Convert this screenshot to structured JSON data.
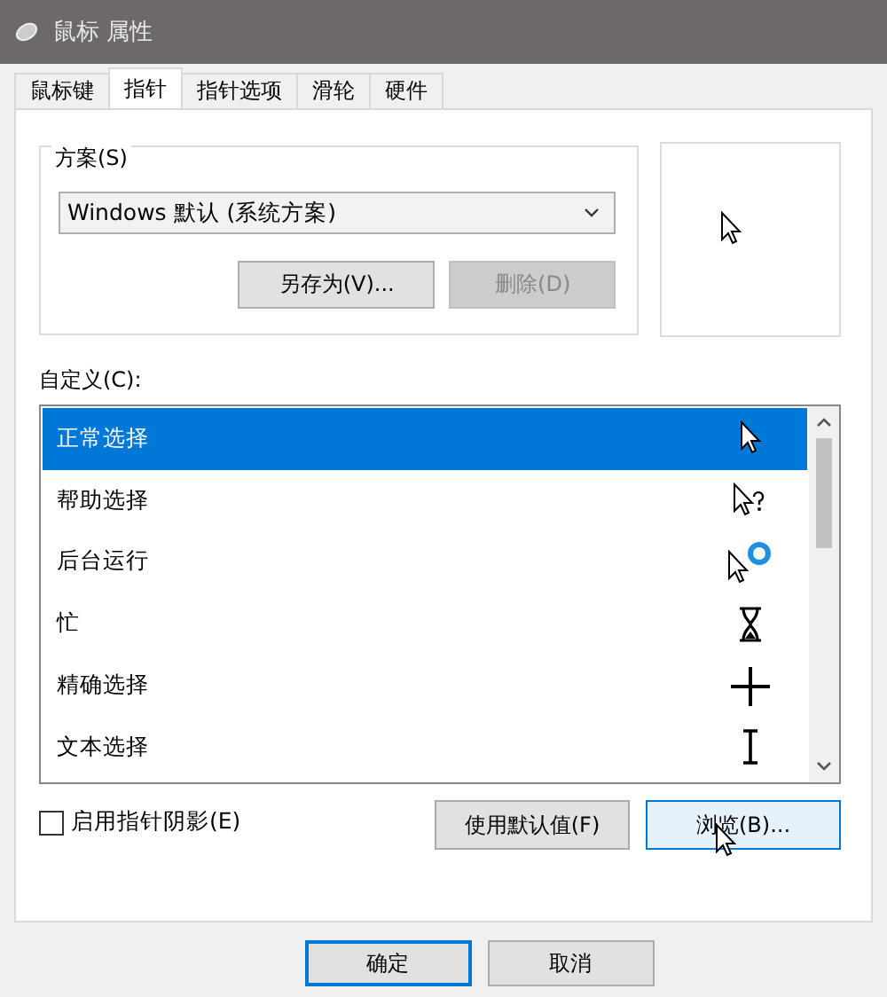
{
  "window": {
    "title": "鼠标 属性"
  },
  "tabs": [
    {
      "label": "鼠标键",
      "selected": false
    },
    {
      "label": "指针",
      "selected": true
    },
    {
      "label": "指针选项",
      "selected": false
    },
    {
      "label": "滑轮",
      "selected": false
    },
    {
      "label": "硬件",
      "selected": false
    }
  ],
  "scheme": {
    "label": "方案(S)",
    "value": "Windows 默认 (系统方案)",
    "buttons": [
      {
        "label": "另存为(V)...",
        "disabled": false
      },
      {
        "label": "删除(D)",
        "disabled": true
      }
    ],
    "preview": {
      "kind": "arrow"
    }
  },
  "customize": {
    "label": "自定义(C):",
    "items": [
      {
        "name": "正常选择",
        "kind": "arrow",
        "selected": true
      },
      {
        "name": "帮助选择",
        "kind": "help",
        "selected": false
      },
      {
        "name": "后台运行",
        "kind": "working",
        "selected": false
      },
      {
        "name": "忙",
        "kind": "busy",
        "selected": false
      },
      {
        "name": "精确选择",
        "kind": "cross",
        "selected": false
      },
      {
        "name": "文本选择",
        "kind": "text",
        "selected": false
      }
    ]
  },
  "shadow": {
    "label": "启用指针阴影(E)",
    "checked": false
  },
  "buttons": [
    {
      "label": "使用默认值(F)",
      "hovered": false
    },
    {
      "label": "浏览(B)...",
      "hovered": true
    }
  ],
  "footer": [
    {
      "label": "确定",
      "default": true
    },
    {
      "label": "取消",
      "default": false
    }
  ]
}
